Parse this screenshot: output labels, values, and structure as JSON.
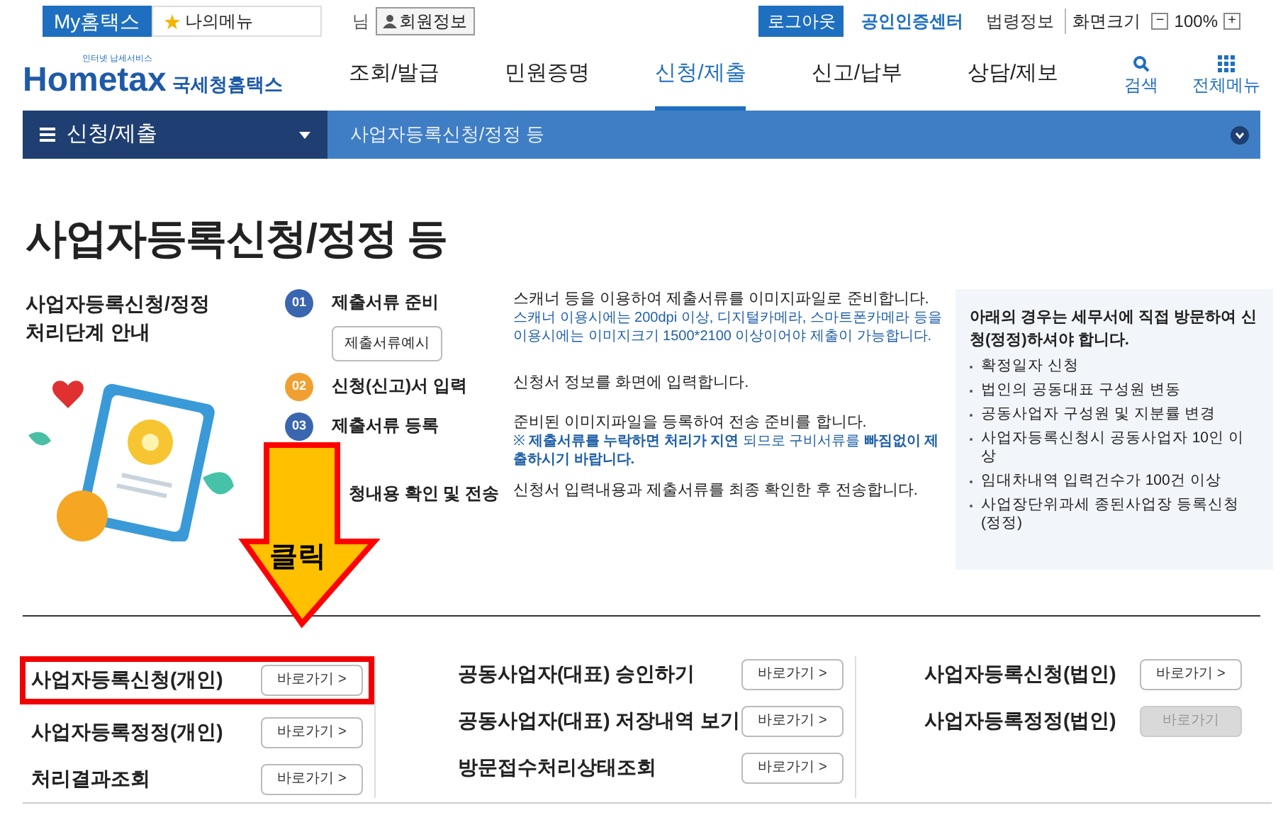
{
  "top_bar": {
    "my_tab": "My홈택스",
    "my_menu": "나의메뉴",
    "user_suffix": "님",
    "member_info": "회원정보",
    "logout": "로그아웃",
    "cert_center": "공인인증센터",
    "law_info": "법령정보",
    "zoom_label": "화면크기",
    "zoom_out": "−",
    "zoom_value": "100%",
    "zoom_in": "+"
  },
  "header": {
    "logo_small": "인터넷 납세서비스",
    "logo_main": "Hometax",
    "logo_kr": "국세청홈택스",
    "nav": [
      {
        "label": "조회/발급",
        "selected": false
      },
      {
        "label": "민원증명",
        "selected": false
      },
      {
        "label": "신청/제출",
        "selected": true
      },
      {
        "label": "신고/납부",
        "selected": false
      },
      {
        "label": "상담/제보",
        "selected": false
      }
    ],
    "search": "검색",
    "all_menu": "전체메뉴"
  },
  "breadcrumb": {
    "section": "신청/제출",
    "current": "사업자등록신청/정정 등"
  },
  "page_title": "사업자등록신청/정정 등",
  "guide_title": "사업자등록신청/정정 처리단계 안내",
  "steps": [
    {
      "number": "01",
      "color": "#3a66b0",
      "label": "제출서류 준비",
      "button": "제출서류예시",
      "desc": "스캐너 등을 이용하여 제출서류를 이미지파일로 준비합니다.",
      "note": "스캐너 이용시에는 200dpi 이상, 디지털카메라, 스마트폰카메라 등을 이용시에는 이미지크기 1500*2100 이상이어야 제출이 가능합니다."
    },
    {
      "number": "02",
      "color": "#f0a030",
      "label": "신청(신고)서 입력",
      "desc": "신청서 정보를 화면에 입력합니다."
    },
    {
      "number": "03",
      "color": "#3a66b0",
      "label": "제출서류 등록",
      "desc": "준비된 이미지파일을 등록하여 전송 준비를 합니다.",
      "note": "※ **제출서류를 누락하면 처리가 지연** 되므로 구비서류를 **빠짐없이 제출하시기 바랍니다.**"
    },
    {
      "label": "청내용 확인 및 전송",
      "desc": "신청서 입력내용과 제출서류를 최종 확인한 후 전송합니다."
    }
  ],
  "visit_box": {
    "title": "아래의 경우는 세무서에 직접 방문하여 신청(정정)하셔야 합니다.",
    "items": [
      "확정일자 신청",
      "법인의 공동대표 구성원 변동",
      "공동사업자 구성원 및 지분률 변경",
      "사업자등록신청시 공동사업자 10인 이상",
      "임대차내역 입력건수가 100건 이상",
      "사업장단위과세 종된사업장 등록신청(정정)"
    ]
  },
  "callout": "클릭",
  "link_columns": [
    [
      {
        "label": "사업자등록신청(개인)",
        "button": "바로가기 >",
        "highlighted": true,
        "disabled": false
      },
      {
        "label": "사업자등록정정(개인)",
        "button": "바로가기 >",
        "highlighted": false,
        "disabled": false
      },
      {
        "label": "처리결과조회",
        "button": "바로가기 >",
        "highlighted": false,
        "disabled": false
      }
    ],
    [
      {
        "label": "공동사업자(대표) 승인하기",
        "button": "바로가기 >",
        "highlighted": false,
        "disabled": false
      },
      {
        "label": "공동사업자(대표) 저장내역 보기",
        "button": "바로가기 >",
        "highlighted": false,
        "disabled": false
      },
      {
        "label": "방문접수처리상태조회",
        "button": "바로가기 >",
        "highlighted": false,
        "disabled": false
      }
    ],
    [
      {
        "label": "사업자등록신청(법인)",
        "button": "바로가기 >",
        "highlighted": false,
        "disabled": false
      },
      {
        "label": "사업자등록정정(법인)",
        "button": "바로가기",
        "highlighted": false,
        "disabled": true
      }
    ]
  ]
}
